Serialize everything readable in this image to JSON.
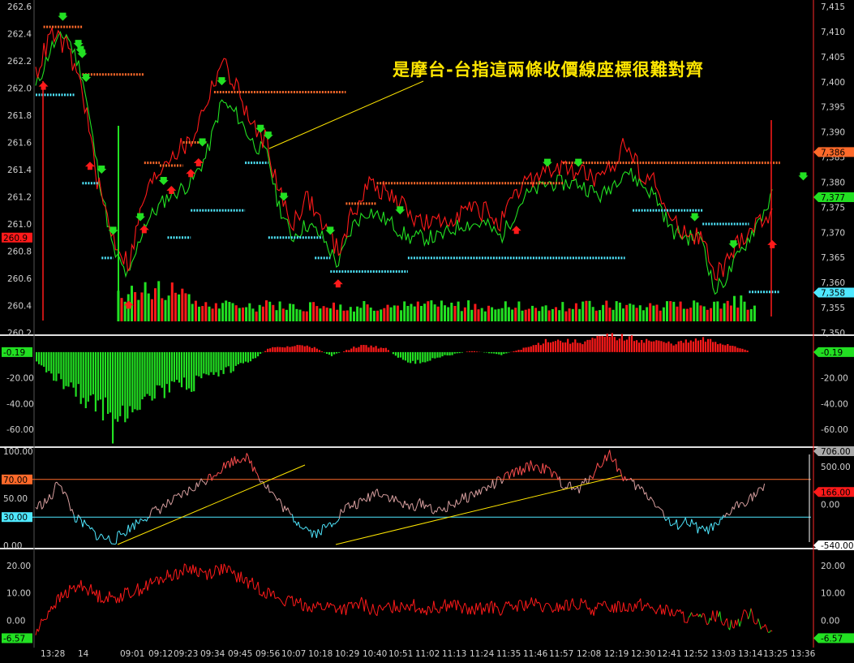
{
  "annotation": "是摩台-台指這兩條收價線座標很難對齊",
  "colors": {
    "up": "#ff1a1a",
    "down": "#22e022",
    "sell": "#ff6a2a",
    "buy": "#4fe8ff",
    "yellow": "#ffe600",
    "axis": "#d0d0d0",
    "sep": "#e0e0e0",
    "grid": "#2a2a2a"
  },
  "time_labels": [
    "13:28",
    "14",
    "09:01",
    "09:12",
    "09:23",
    "09:34",
    "09:45",
    "09:56",
    "10:07",
    "10:18",
    "10:29",
    "10:40",
    "10:51",
    "11:02",
    "11:13",
    "11:24",
    "11:35",
    "11:46",
    "11:57",
    "12:08",
    "12:19",
    "12:30",
    "12:41",
    "12:52",
    "13:03",
    "13:14",
    "13:25",
    "13:36"
  ],
  "chart_data": [
    {
      "type": "line",
      "title": "",
      "left_axis": {
        "ticks": [
          "262.6",
          "262.4",
          "262.2",
          "262.0",
          "261.8",
          "261.6",
          "261.4",
          "261.2",
          "261.0",
          "260.8",
          "260.6",
          "260.4",
          "260.2"
        ],
        "range": [
          260.2,
          262.6
        ],
        "current": "260.9"
      },
      "right_axis": {
        "ticks": [
          "7,415",
          "7,410",
          "7,405",
          "7,400",
          "7,395",
          "7,390",
          "7,385",
          "7,380",
          "7,375",
          "7,370",
          "7,365",
          "7,360",
          "7,355",
          "7,350"
        ],
        "range": [
          7350,
          7415
        ],
        "badges": [
          {
            "label": "7,386",
            "value": 7386,
            "color": "#ff6a2a"
          },
          {
            "label": "7,377",
            "value": 7377,
            "color": "#22e022"
          },
          {
            "label": "7,358",
            "value": 7358,
            "color": "#4fe8ff"
          }
        ]
      },
      "series": [
        {
          "color": "#22e022",
          "axis": "left",
          "anchors": [
            [
              0,
              262.0
            ],
            [
              0.02,
              262.3
            ],
            [
              0.04,
              262.4
            ],
            [
              0.06,
              262.1
            ],
            [
              0.08,
              261.4
            ],
            [
              0.1,
              260.8
            ],
            [
              0.12,
              260.6
            ],
            [
              0.14,
              261.0
            ],
            [
              0.17,
              261.2
            ],
            [
              0.2,
              261.3
            ],
            [
              0.22,
              261.5
            ],
            [
              0.24,
              261.9
            ],
            [
              0.26,
              261.8
            ],
            [
              0.28,
              261.6
            ],
            [
              0.3,
              261.5
            ],
            [
              0.31,
              261.2
            ],
            [
              0.33,
              260.9
            ],
            [
              0.35,
              261.0
            ],
            [
              0.37,
              260.9
            ],
            [
              0.39,
              260.7
            ],
            [
              0.41,
              261.0
            ],
            [
              0.43,
              261.1
            ],
            [
              0.46,
              261.0
            ],
            [
              0.48,
              260.9
            ],
            [
              0.5,
              260.9
            ],
            [
              0.52,
              260.9
            ],
            [
              0.55,
              261.0
            ],
            [
              0.58,
              261.0
            ],
            [
              0.6,
              260.9
            ],
            [
              0.63,
              261.2
            ],
            [
              0.66,
              261.3
            ],
            [
              0.7,
              261.3
            ],
            [
              0.73,
              261.2
            ],
            [
              0.76,
              261.4
            ],
            [
              0.78,
              261.3
            ],
            [
              0.8,
              261.2
            ],
            [
              0.82,
              260.95
            ],
            [
              0.84,
              260.9
            ],
            [
              0.86,
              260.9
            ],
            [
              0.875,
              260.5
            ],
            [
              0.89,
              260.6
            ],
            [
              0.91,
              260.8
            ],
            [
              0.93,
              261.0
            ],
            [
              0.95,
              261.2
            ]
          ]
        },
        {
          "color": "#ff1a1a",
          "axis": "left",
          "anchors": [
            [
              0,
              262.1
            ],
            [
              0.02,
              262.4
            ],
            [
              0.04,
              262.3
            ],
            [
              0.06,
              262.0
            ],
            [
              0.08,
              261.3
            ],
            [
              0.1,
              260.9
            ],
            [
              0.12,
              260.7
            ],
            [
              0.14,
              261.2
            ],
            [
              0.17,
              261.5
            ],
            [
              0.2,
              261.6
            ],
            [
              0.22,
              261.9
            ],
            [
              0.24,
              262.2
            ],
            [
              0.26,
              262.0
            ],
            [
              0.28,
              261.7
            ],
            [
              0.3,
              261.6
            ],
            [
              0.31,
              261.3
            ],
            [
              0.33,
              261.0
            ],
            [
              0.35,
              261.2
            ],
            [
              0.37,
              261.0
            ],
            [
              0.39,
              260.8
            ],
            [
              0.41,
              261.1
            ],
            [
              0.43,
              261.3
            ],
            [
              0.46,
              261.2
            ],
            [
              0.48,
              261.1
            ],
            [
              0.5,
              261.0
            ],
            [
              0.52,
              261.0
            ],
            [
              0.55,
              261.1
            ],
            [
              0.58,
              261.1
            ],
            [
              0.6,
              261.0
            ],
            [
              0.63,
              261.3
            ],
            [
              0.66,
              261.4
            ],
            [
              0.7,
              261.4
            ],
            [
              0.73,
              261.3
            ],
            [
              0.76,
              261.6
            ],
            [
              0.78,
              261.4
            ],
            [
              0.8,
              261.3
            ],
            [
              0.82,
              261.0
            ],
            [
              0.84,
              260.95
            ],
            [
              0.86,
              260.9
            ],
            [
              0.875,
              260.6
            ],
            [
              0.89,
              260.7
            ],
            [
              0.91,
              260.9
            ],
            [
              0.93,
              261.0
            ],
            [
              0.95,
              261.1
            ]
          ]
        }
      ]
    },
    {
      "type": "bar",
      "title": "",
      "axis": {
        "ticks": [
          "-20.00",
          "-40.00",
          "-60.00"
        ],
        "range": [
          -70,
          10
        ],
        "current": "-0.19"
      },
      "series": [
        {
          "anchors": [
            [
              0,
              -10
            ],
            [
              0.05,
              -30
            ],
            [
              0.09,
              -50
            ],
            [
              0.1,
              -63
            ],
            [
              0.12,
              -42
            ],
            [
              0.16,
              -32
            ],
            [
              0.2,
              -27
            ],
            [
              0.25,
              -15
            ],
            [
              0.28,
              -5
            ],
            [
              0.3,
              3
            ],
            [
              0.35,
              6
            ],
            [
              0.38,
              -3
            ],
            [
              0.42,
              6
            ],
            [
              0.45,
              3
            ],
            [
              0.48,
              -10
            ],
            [
              0.52,
              -4
            ],
            [
              0.56,
              1
            ],
            [
              0.6,
              -2
            ],
            [
              0.64,
              5
            ],
            [
              0.66,
              10
            ],
            [
              0.7,
              8
            ],
            [
              0.74,
              13
            ],
            [
              0.78,
              10
            ],
            [
              0.82,
              7
            ],
            [
              0.86,
              10
            ],
            [
              0.9,
              5
            ],
            [
              0.92,
              1
            ]
          ]
        }
      ]
    },
    {
      "type": "line",
      "title": "",
      "left_axis": {
        "ticks": [
          "100.00",
          "70.00",
          "50.00",
          "30.00",
          "0.00"
        ],
        "range": [
          0,
          100
        ],
        "badges": [
          {
            "label": "70.00",
            "value": 70,
            "color": "#ff6a2a"
          },
          {
            "label": "30.00",
            "value": 30,
            "color": "#4fe8ff"
          }
        ]
      },
      "right_axis": {
        "ticks": [
          "500.00",
          "0.00"
        ],
        "range": [
          -540,
          706
        ],
        "badges": [
          {
            "label": "706.00",
            "value": 706,
            "color": "#aaaaaa"
          },
          {
            "label": "166.00",
            "value": 166,
            "color": "#ff1a1a"
          },
          {
            "label": "-540.00",
            "value": -540,
            "color": "#ffffff"
          }
        ]
      },
      "thresholds": [
        70,
        30
      ],
      "series": [
        {
          "anchors": [
            [
              0,
              40
            ],
            [
              0.02,
              50
            ],
            [
              0.03,
              70
            ],
            [
              0.05,
              30
            ],
            [
              0.08,
              10
            ],
            [
              0.1,
              5
            ],
            [
              0.14,
              30
            ],
            [
              0.18,
              48
            ],
            [
              0.22,
              70
            ],
            [
              0.25,
              88
            ],
            [
              0.27,
              95
            ],
            [
              0.29,
              72
            ],
            [
              0.31,
              50
            ],
            [
              0.33,
              30
            ],
            [
              0.36,
              12
            ],
            [
              0.38,
              22
            ],
            [
              0.4,
              40
            ],
            [
              0.42,
              45
            ],
            [
              0.44,
              58
            ],
            [
              0.46,
              50
            ],
            [
              0.48,
              40
            ],
            [
              0.5,
              45
            ],
            [
              0.52,
              35
            ],
            [
              0.54,
              45
            ],
            [
              0.58,
              60
            ],
            [
              0.62,
              78
            ],
            [
              0.64,
              85
            ],
            [
              0.66,
              80
            ],
            [
              0.68,
              65
            ],
            [
              0.7,
              58
            ],
            [
              0.72,
              78
            ],
            [
              0.74,
              98
            ],
            [
              0.76,
              70
            ],
            [
              0.78,
              60
            ],
            [
              0.8,
              45
            ],
            [
              0.82,
              20
            ],
            [
              0.84,
              25
            ],
            [
              0.86,
              15
            ],
            [
              0.88,
              20
            ],
            [
              0.9,
              40
            ],
            [
              0.92,
              50
            ],
            [
              0.94,
              60
            ]
          ]
        }
      ]
    },
    {
      "type": "line",
      "title": "",
      "axis": {
        "ticks": [
          "20.00",
          "10.00",
          "0.00"
        ],
        "range": [
          -10,
          25
        ],
        "current": "-6.57"
      },
      "series": [
        {
          "anchors": [
            [
              0,
              -5
            ],
            [
              0.02,
              5
            ],
            [
              0.04,
              10
            ],
            [
              0.06,
              13
            ],
            [
              0.08,
              9
            ],
            [
              0.1,
              8
            ],
            [
              0.12,
              10
            ],
            [
              0.14,
              12
            ],
            [
              0.16,
              15
            ],
            [
              0.18,
              17
            ],
            [
              0.2,
              19
            ],
            [
              0.22,
              17
            ],
            [
              0.24,
              19
            ],
            [
              0.26,
              16
            ],
            [
              0.28,
              13
            ],
            [
              0.3,
              10
            ],
            [
              0.32,
              7
            ],
            [
              0.34,
              6
            ],
            [
              0.36,
              5
            ],
            [
              0.38,
              5
            ],
            [
              0.4,
              4
            ],
            [
              0.42,
              6
            ],
            [
              0.44,
              3
            ],
            [
              0.46,
              5
            ],
            [
              0.48,
              6
            ],
            [
              0.5,
              4
            ],
            [
              0.52,
              5
            ],
            [
              0.54,
              6
            ],
            [
              0.56,
              3
            ],
            [
              0.58,
              5
            ],
            [
              0.6,
              4
            ],
            [
              0.62,
              5
            ],
            [
              0.64,
              6
            ],
            [
              0.66,
              4
            ],
            [
              0.68,
              5
            ],
            [
              0.7,
              6
            ],
            [
              0.72,
              4
            ],
            [
              0.74,
              5
            ],
            [
              0.76,
              5
            ],
            [
              0.78,
              6
            ],
            [
              0.8,
              4
            ],
            [
              0.82,
              3
            ],
            [
              0.84,
              1
            ],
            [
              0.86,
              0
            ],
            [
              0.88,
              2
            ],
            [
              0.9,
              -2
            ],
            [
              0.92,
              3
            ],
            [
              0.94,
              -2
            ],
            [
              0.95,
              -6
            ]
          ]
        }
      ]
    }
  ]
}
